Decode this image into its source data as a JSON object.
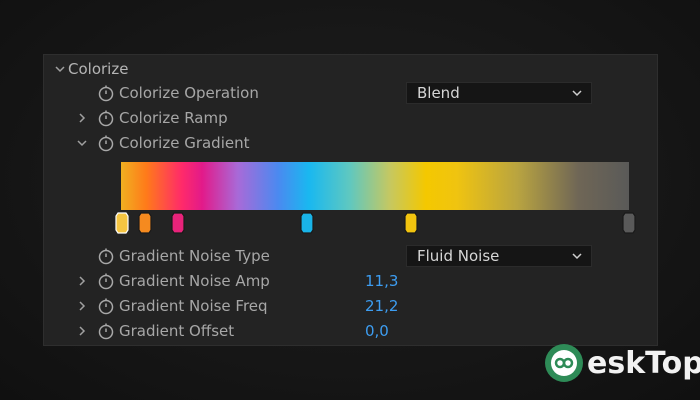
{
  "section": {
    "title": "Colorize"
  },
  "properties": {
    "colorize_operation": {
      "label": "Colorize Operation",
      "value": "Blend"
    },
    "colorize_ramp": {
      "label": "Colorize Ramp"
    },
    "colorize_gradient": {
      "label": "Colorize Gradient"
    },
    "gradient_noise_type": {
      "label": "Gradient Noise Type",
      "value": "Fluid Noise"
    },
    "gradient_noise_amp": {
      "label": "Gradient Noise Amp",
      "value": "11,3"
    },
    "gradient_noise_freq": {
      "label": "Gradient Noise Freq",
      "value": "21,2"
    },
    "gradient_offset": {
      "label": "Gradient Offset",
      "value": "0,0"
    }
  },
  "gradient_stops": [
    {
      "color": "#f5c542",
      "selected": true
    },
    {
      "color": "#f58a1f"
    },
    {
      "color": "#e8237a"
    },
    {
      "color": "#19b4e8"
    },
    {
      "color": "#f2c40f"
    },
    {
      "color": "#5a5a5a"
    }
  ],
  "colors": {
    "value_blue": "#3d9df1",
    "panel_bg": "#232323"
  },
  "watermark": {
    "text": "eskTop"
  }
}
